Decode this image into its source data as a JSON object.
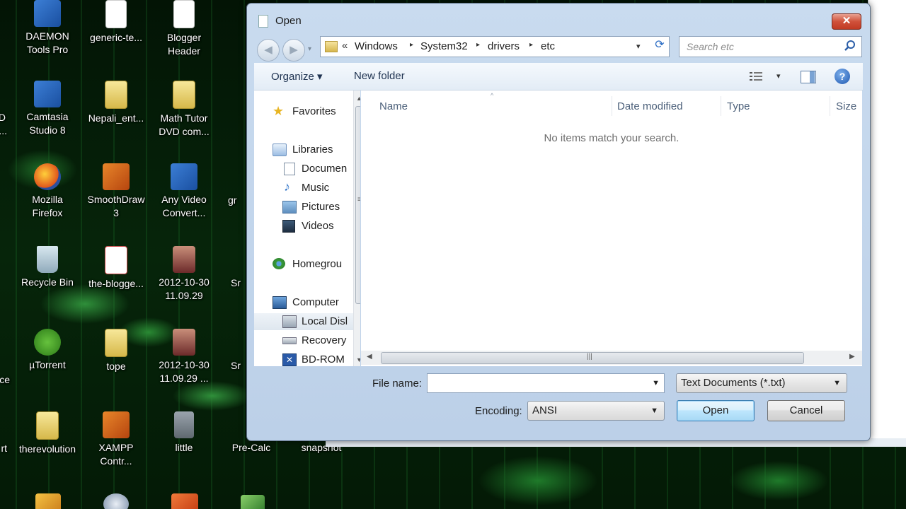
{
  "desktop": {
    "icons": [
      {
        "label_1": "DAEMON",
        "label_2": "Tools Pro"
      },
      {
        "label_1": "generic-te...",
        "label_2": ""
      },
      {
        "label_1": "Blogger",
        "label_2": "Header"
      },
      {
        "label_1": "Camtasia",
        "label_2": "Studio 8"
      },
      {
        "label_1": "Nepali_ent...",
        "label_2": ""
      },
      {
        "label_1": "Math Tutor",
        "label_2": "DVD com..."
      },
      {
        "label_1": "Mozilla",
        "label_2": "Firefox"
      },
      {
        "label_1": "SmoothDraw",
        "label_2": "3"
      },
      {
        "label_1": "Any Video",
        "label_2": "Convert..."
      },
      {
        "label_1": "Recycle Bin",
        "label_2": ""
      },
      {
        "label_1": "the-blogge...",
        "label_2": ""
      },
      {
        "label_1": "2012-10-30",
        "label_2": "11.09.29"
      },
      {
        "label_1": "µTorrent",
        "label_2": ""
      },
      {
        "label_1": "tope",
        "label_2": ""
      },
      {
        "label_1": "2012-10-30",
        "label_2": "11.09.29 ..."
      },
      {
        "label_1": "therevolution",
        "label_2": ""
      },
      {
        "label_1": "XAMPP",
        "label_2": "Contr..."
      },
      {
        "label_1": "little",
        "label_2": ""
      },
      {
        "label_1": "Pre-Calc",
        "label_2": ""
      },
      {
        "label_1": "snapshot",
        "label_2": ""
      }
    ],
    "edge_labels": [
      "D",
      "...",
      "gr",
      "Sr",
      "Sr",
      "ce",
      "rt"
    ]
  },
  "dialog": {
    "title": "Open",
    "close_label": "✕",
    "nav": {
      "back": "◀",
      "forward": "▶",
      "dropdown": "▾"
    },
    "address": {
      "overflow": "«",
      "crumbs": [
        "Windows",
        "System32",
        "drivers",
        "etc"
      ],
      "separator": "▸",
      "dropdown": "▾",
      "refresh": "⟳"
    },
    "search": {
      "placeholder": "Search etc"
    },
    "toolbar": {
      "organize": "Organize ▾",
      "new_folder": "New folder",
      "views_dropdown": "▾",
      "help": "?"
    },
    "navpane": {
      "items": [
        {
          "label": "Favorites",
          "icon": "star-icon"
        },
        {
          "label": "Libraries",
          "icon": "libraries-icon"
        },
        {
          "label": "Documen",
          "icon": "documents-icon"
        },
        {
          "label": "Music",
          "icon": "music-icon"
        },
        {
          "label": "Pictures",
          "icon": "pictures-icon"
        },
        {
          "label": "Videos",
          "icon": "videos-icon"
        },
        {
          "label": "Homegrou",
          "icon": "homegroup-icon"
        },
        {
          "label": "Computer",
          "icon": "computer-icon"
        },
        {
          "label": "Local Disl",
          "icon": "drive-icon"
        },
        {
          "label": "Recovery",
          "icon": "drive-icon"
        },
        {
          "label": "BD-ROM",
          "icon": "bdrom-icon"
        }
      ],
      "scroll_up": "▲",
      "scroll_down": "▼",
      "grip": "≡"
    },
    "filepane": {
      "columns": [
        "Name",
        "Date modified",
        "Type",
        "Size"
      ],
      "sort_arrow": "^",
      "empty_message": "No items match your search.",
      "scroll_left": "◀",
      "scroll_right": "▶",
      "grip": "|||"
    },
    "bottom": {
      "filename_label": "File name:",
      "filename_value": "",
      "filetype_value": "Text Documents (*.txt)",
      "encoding_label": "Encoding:",
      "encoding_value": "ANSI",
      "dropdown": "▼",
      "open_label": "Open",
      "cancel_label": "Cancel"
    }
  }
}
